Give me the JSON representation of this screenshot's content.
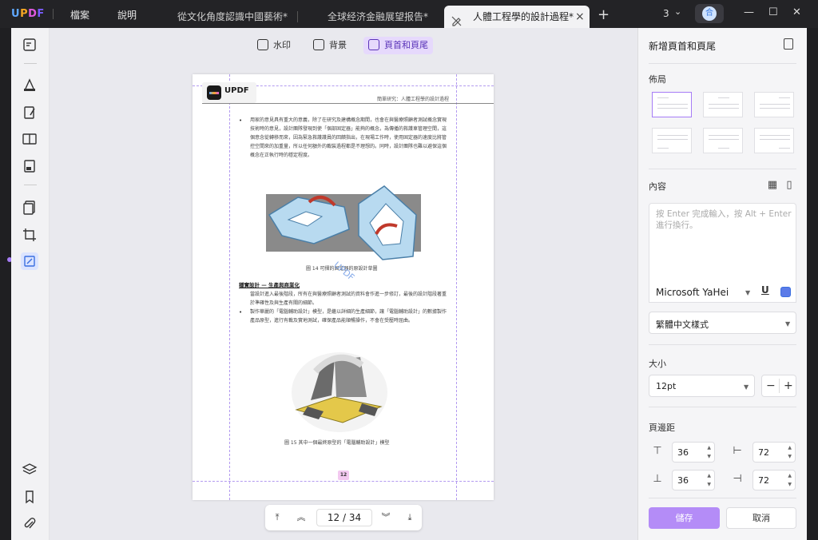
{
  "app": {
    "logo": [
      "U",
      "P",
      "D",
      "F"
    ]
  },
  "menu": {
    "file": "檔案",
    "help": "說明"
  },
  "tabs": [
    {
      "label": "從文化角度認識中國藝術*"
    },
    {
      "label": "全球经济金融展望报告*"
    },
    {
      "label": "人體工程學的設計過程*"
    }
  ],
  "titlebar": {
    "tab_count": "3",
    "avatar_initial": "合"
  },
  "toolbar": {
    "watermark": "水印",
    "background": "背景",
    "header_footer": "頁首和頁尾"
  },
  "document": {
    "header_right": "簡單研究：人體工程學的設計過程",
    "logo_text": "UPDF",
    "para1": "用家的意見具有重大的意義，除了在研究及建構概念期間，也會在與醫療照顧者測試概念實現技術時的意見，設計團隊發現到使「個部固定器」能夠的概念，為傳播的救護車管理空間，這個意念從轉移而來，因為緊急救護護員的回饋指出，在現場工作時，使用固定器的速度比將管控空間來的加重量，所以任何額外的載裝過程都是不理想的。同時，設計團隊也難以避保這個概念在正執行時的穩定程度。",
    "fig1_caption": "圖 14 可摺的固定器的原設計草圖",
    "subhead": "穩實設計 — 生產與商業化",
    "para2": "當設計進入最後階段，所有在與醫療照顧者測試的資料會作進一步修訂，最後的設計階段著重於準確性及與生產有關的細節。",
    "para3": "製作華麗的「電腦輔助設計」模型，是繼以詳細的生產細節，讓「電腦輔助設計」的數據製作產品原型，進行有載及實地測試，確保產品能順暢操作，不會在受壓時屈曲。",
    "fig2_caption": "圖 15 其中一個最終原型的「電腦輔助設計」模型",
    "watermark_text": "UPDF",
    "page_number": "12"
  },
  "pager": {
    "current": "12",
    "separator": "/",
    "total": "34"
  },
  "panel": {
    "title": "新增頁首和頁尾",
    "layout_label": "佈局",
    "content_label": "內容",
    "content_placeholder": "按 Enter 完成輸入，按 Alt + Enter 進行換行。",
    "font": "Microsoft YaHei",
    "underline": "U",
    "style": "繁體中文樣式",
    "size_label": "大小",
    "size": "12pt",
    "minus": "−",
    "plus": "+",
    "margin_label": "頁邊距",
    "margin_top": "36",
    "margin_bottom": "36",
    "margin_left": "72",
    "margin_right": "72",
    "save": "儲存",
    "cancel": "取消"
  },
  "colors": {
    "accent": "#b48cf7",
    "selected_tab": "#e6d9fc",
    "title_bar": "#232326"
  }
}
